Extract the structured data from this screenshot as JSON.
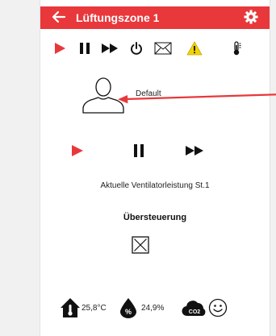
{
  "header": {
    "title": "Lüftungszone 1",
    "back_icon": "arrow-left-icon",
    "settings_icon": "gear-icon"
  },
  "toolbar": {
    "icons": [
      "play-icon",
      "pause-icon",
      "fast-forward-icon",
      "power-icon",
      "mail-icon",
      "warning-icon",
      "thermometer-icon"
    ]
  },
  "profile": {
    "label": "Default",
    "icon": "user-icon"
  },
  "controls": {
    "icons": [
      "play-icon",
      "pause-icon",
      "fast-forward-icon"
    ]
  },
  "status": {
    "fan_level": "Aktuelle Ventilatorleistung St.1"
  },
  "override": {
    "title": "Übersteuerung",
    "checkbox_icon": "checkbox-crossed-icon"
  },
  "sensors": {
    "temperature": "25,8°C",
    "humidity": "24,9%",
    "co2_label": "CO2",
    "air_quality_icon": "smiley-icon"
  },
  "colors": {
    "accent": "#e8383b",
    "warning": "#f2d20a",
    "background": "#f1f1f1"
  }
}
